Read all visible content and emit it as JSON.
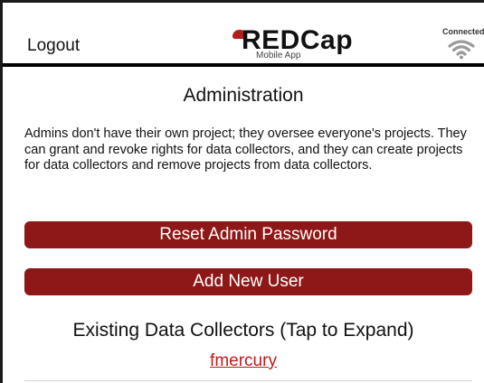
{
  "header": {
    "logout_label": "Logout",
    "logo_text": "REDCap",
    "logo_subtitle": "Mobile App",
    "connection_status": "Connected",
    "connection_icon": "wifi-icon"
  },
  "main": {
    "title": "Administration",
    "description": "Admins don't have their own project; they oversee everyone's projects. They can grant and revoke rights for data collectors, and they can create projects for data collectors and remove projects from data collectors.",
    "reset_password_label": "Reset Admin Password",
    "add_user_label": "Add New User",
    "collectors_heading": "Existing Data Collectors (Tap to Expand)",
    "collectors": [
      "fmercury"
    ]
  },
  "colors": {
    "accent": "#8e1717",
    "link": "#c21a1a",
    "header_border": "#000000"
  }
}
